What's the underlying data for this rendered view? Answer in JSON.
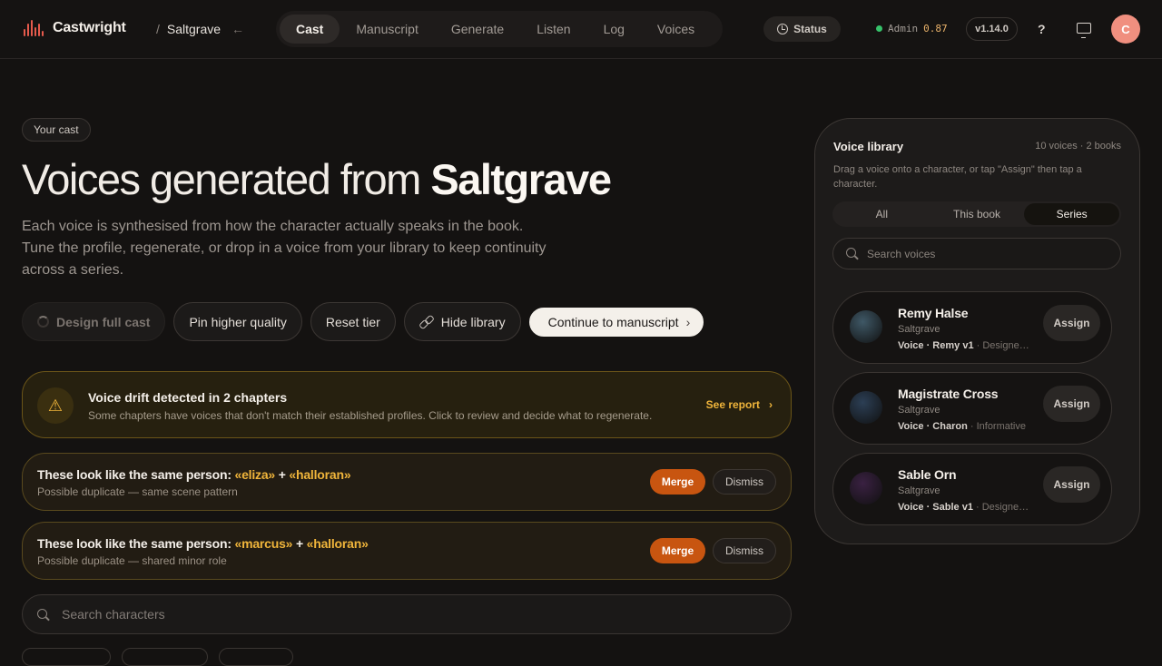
{
  "app": {
    "name": "Castwright",
    "book": "Saltgrave"
  },
  "nav": {
    "tabs": [
      "Cast",
      "Manuscript",
      "Generate",
      "Listen",
      "Log",
      "Voices"
    ],
    "active": "Cast"
  },
  "header_right": {
    "status": "Status",
    "admin_label": "Admin",
    "admin_value": "0.87",
    "version": "v1.14.0",
    "help": "?",
    "avatar_initial": "C"
  },
  "hero": {
    "chip": "Your cast",
    "title_prefix": "Voices generated from ",
    "title_book": "Saltgrave",
    "subtitle": "Each voice is synthesised from how the character actually speaks in the book. Tune the profile, regenerate, or drop in a voice from your library to keep continuity across a series."
  },
  "actions": {
    "design_full_cast": "Design full cast",
    "pin_higher_quality": "Pin higher quality",
    "reset_tier": "Reset tier",
    "hide_library": "Hide library",
    "continue": "Continue to manuscript"
  },
  "drift": {
    "title": "Voice drift detected in 2 chapters",
    "subtitle": "Some chapters have voices that don't match their established profiles. Click to review and decide what to regenerate.",
    "link": "See report"
  },
  "duplicates": [
    {
      "prefix": "These look like the same person: ",
      "a": "«eliza»",
      "plus": " + ",
      "b": "«halloran»",
      "subtitle": "Possible duplicate — same scene pattern",
      "merge": "Merge",
      "dismiss": "Dismiss"
    },
    {
      "prefix": "These look like the same person: ",
      "a": "«marcus»",
      "plus": " + ",
      "b": "«halloran»",
      "subtitle": "Possible duplicate — shared minor role",
      "merge": "Merge",
      "dismiss": "Dismiss"
    }
  ],
  "char_search": {
    "placeholder": "Search characters"
  },
  "library": {
    "title": "Voice library",
    "meta": "10 voices · 2 books",
    "hint": "Drag a voice onto a character, or tap \"Assign\" then tap a character.",
    "tabs": [
      "All",
      "This book",
      "Series"
    ],
    "active_tab": "Series",
    "search_placeholder": "Search voices",
    "voices": [
      {
        "name": "Remy Halse",
        "book": "Saltgrave",
        "voice": "Voice · Remy v1",
        "extra": " · Designed ...",
        "color": "#3f5866",
        "assign": "Assign"
      },
      {
        "name": "Magistrate Cross",
        "book": "Saltgrave",
        "voice": "Voice · Charon",
        "extra": " · Informative",
        "color": "#2c3f55",
        "assign": "Assign"
      },
      {
        "name": "Sable Orn",
        "book": "Saltgrave",
        "voice": "Voice · Sable v1",
        "extra": " · Designed ...",
        "color": "#3a2142",
        "assign": "Assign"
      }
    ]
  }
}
